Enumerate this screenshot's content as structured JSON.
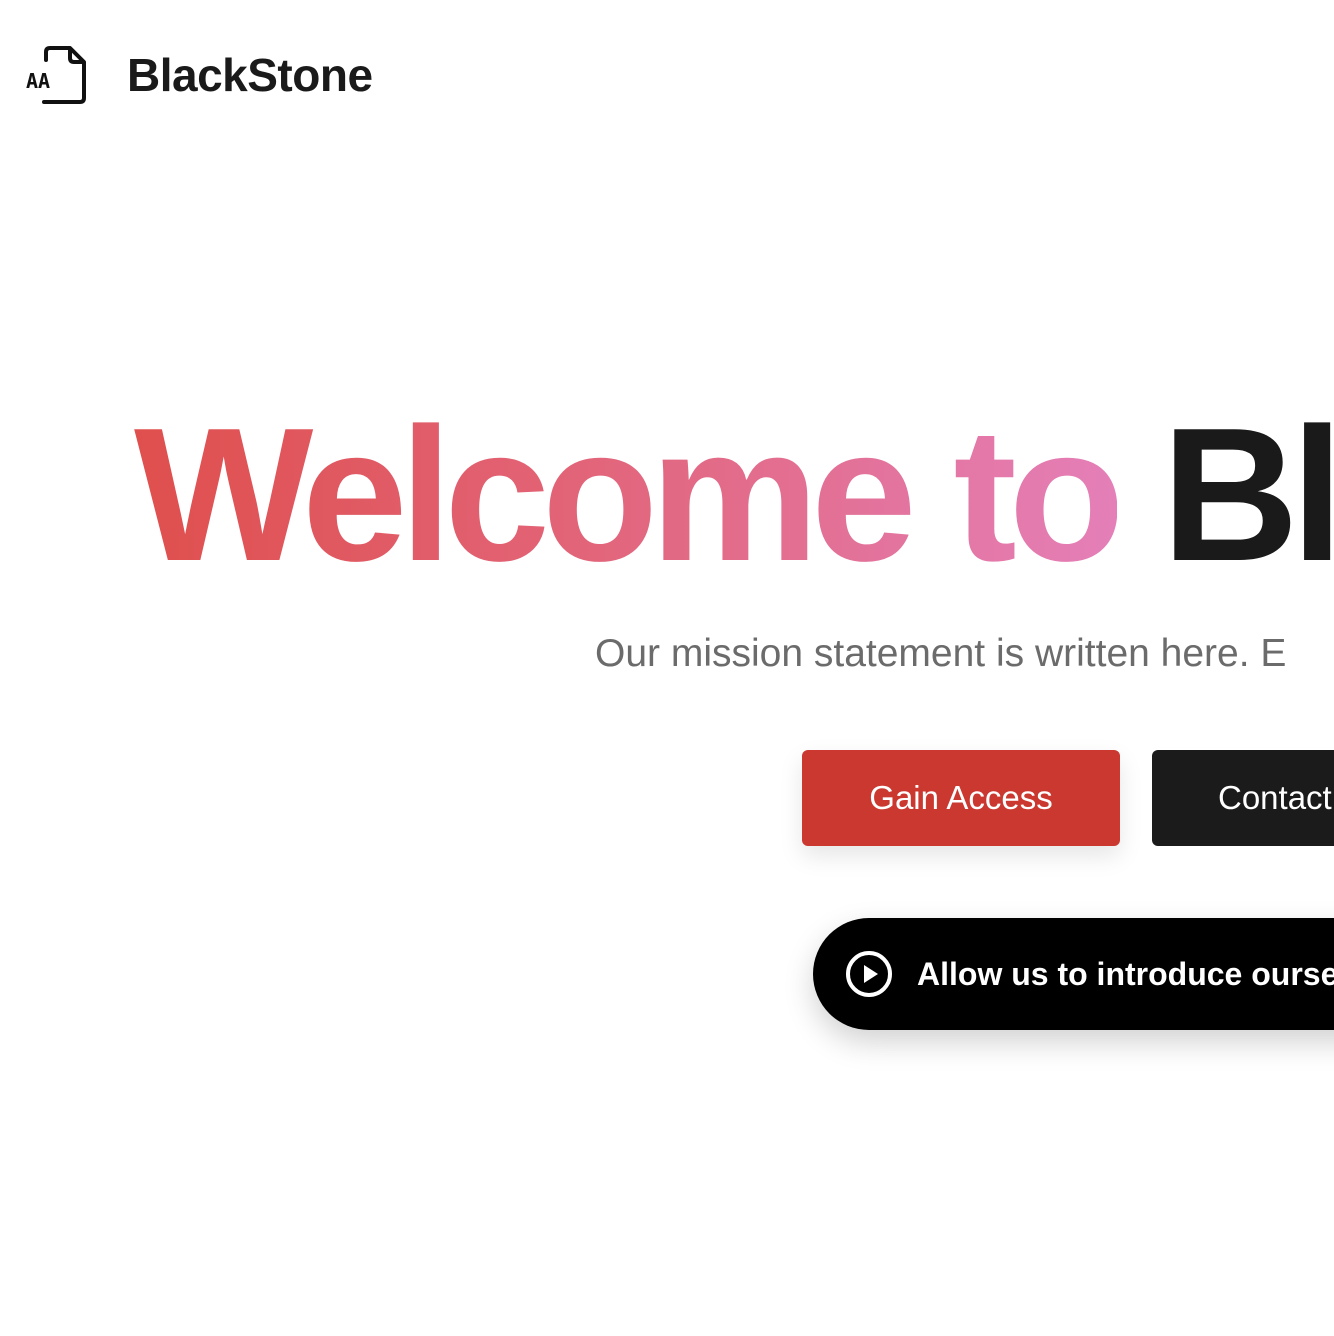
{
  "brand": {
    "name": "BlackStone",
    "logo_icon": "font-file-icon",
    "logo_icon_text": "AA"
  },
  "hero": {
    "title_highlight": "Welcome to",
    "title_rest": "Bla",
    "subtitle": "Our mission statement is written here. E"
  },
  "actions": {
    "primary_label": "Gain Access",
    "secondary_label": "Contact"
  },
  "video": {
    "icon": "play-circle-icon",
    "label": "Allow us to introduce ourse"
  },
  "colors": {
    "gradient_start": "#df4f4d",
    "gradient_end": "#e47fb8",
    "primary_button": "#ca3830",
    "secondary_button": "#1b1b1b",
    "text_dark": "#1a1a1a",
    "text_muted": "#6b6b6b"
  }
}
